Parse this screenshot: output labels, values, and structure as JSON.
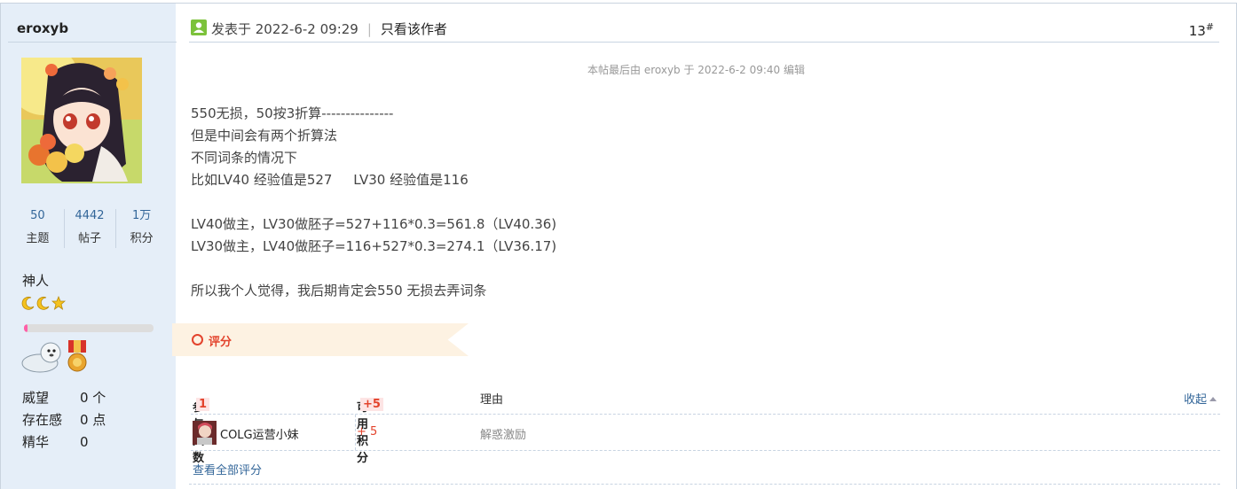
{
  "user": {
    "name": "eroxyb",
    "stats": [
      {
        "value": "50",
        "label": "主题"
      },
      {
        "value": "4442",
        "label": "帖子"
      },
      {
        "value": "1万",
        "label": "积分"
      }
    ],
    "rank": "神人",
    "level_progress": 0.03,
    "attrs": [
      {
        "name": "威望",
        "value": "0 个"
      },
      {
        "name": "存在感",
        "value": "0 点"
      },
      {
        "name": "精华",
        "value": "0"
      }
    ]
  },
  "post": {
    "meta": "发表于 2022-6-2 09:29",
    "only_author": "只看该作者",
    "floor": "13",
    "floor_sup": "#",
    "edit_note": "本帖最后由 eroxyb 于 2022-6-2 09:40 编辑",
    "lines": [
      "550无损，50按3折算---------------",
      "但是中间会有两个折算法",
      "不同词条的情况下",
      "比如LV40 经验值是527     LV30 经验值是116",
      "",
      "LV40做主，LV30做胚子=527+116*0.3=561.8（LV40.36)",
      "LV30做主，LV40做胚子=116+527*0.3=274.1（LV36.17)",
      "",
      "所以我个人觉得，我后期肯定会550 无损去弄词条"
    ]
  },
  "rating": {
    "banner": "评分",
    "participants_label": "参与人数",
    "participants_count": "1",
    "score_label": "可用积分",
    "score_total": "+5",
    "reason_label": "理由",
    "collapse": "收起",
    "rows": [
      {
        "user": "COLG运营小妹",
        "score": "+ 5",
        "reason": "解惑激励"
      }
    ],
    "view_all": "查看全部评分"
  },
  "colors": {
    "sidebar_bg": "#e5eef8",
    "link": "#336699",
    "accent_red": "#e3432c",
    "online_green": "#7cc23b"
  }
}
